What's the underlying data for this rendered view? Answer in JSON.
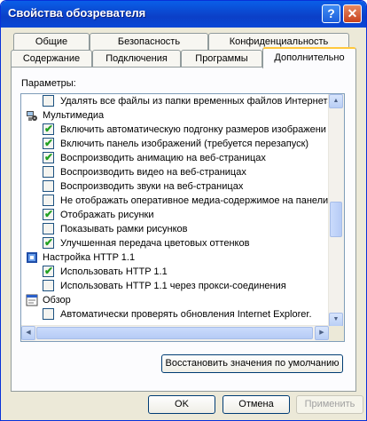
{
  "window": {
    "title": "Свойства обозревателя",
    "help_label": "?",
    "close_label": "✕"
  },
  "tabs": {
    "row1": [
      {
        "label": "Общие"
      },
      {
        "label": "Безопасность"
      },
      {
        "label": "Конфиденциальность"
      }
    ],
    "row2": [
      {
        "label": "Содержание"
      },
      {
        "label": "Подключения"
      },
      {
        "label": "Программы"
      },
      {
        "label": "Дополнительно"
      }
    ]
  },
  "panel": {
    "params_label": "Параметры:",
    "items": [
      {
        "label": "Удалять все файлы из папки временных файлов Интернета",
        "checked": false
      },
      {
        "label": "Мультимедиа",
        "group": true,
        "icon": "multimedia-icon"
      },
      {
        "label": "Включить автоматическую подгонку размеров изображени",
        "checked": true
      },
      {
        "label": "Включить панель изображений (требуется перезапуск)",
        "checked": true
      },
      {
        "label": "Воспроизводить анимацию на веб-страницах",
        "checked": true
      },
      {
        "label": "Воспроизводить видео на веб-страницах",
        "checked": false
      },
      {
        "label": "Воспроизводить звуки на веб-страницах",
        "checked": false
      },
      {
        "label": "Не отображать оперативное медиа-содержимое на панели",
        "checked": false
      },
      {
        "label": "Отображать рисунки",
        "checked": true
      },
      {
        "label": "Показывать рамки рисунков",
        "checked": false
      },
      {
        "label": "Улучшенная передача цветовых оттенков",
        "checked": true
      },
      {
        "label": "Настройка HTTP 1.1",
        "group": true,
        "icon": "http-settings-icon"
      },
      {
        "label": "Использовать HTTP 1.1",
        "checked": true
      },
      {
        "label": "Использовать HTTP 1.1 через прокси-соединения",
        "checked": false
      },
      {
        "label": "Обзор",
        "group": true,
        "icon": "browse-icon"
      },
      {
        "label": "Автоматически проверять обновления Internet Explorer.",
        "checked": false
      }
    ],
    "restore_label": "Восстановить значения по умолчанию"
  },
  "buttons": {
    "ok_label": "OK",
    "cancel_label": "Отмена",
    "apply_label": "Применить"
  }
}
